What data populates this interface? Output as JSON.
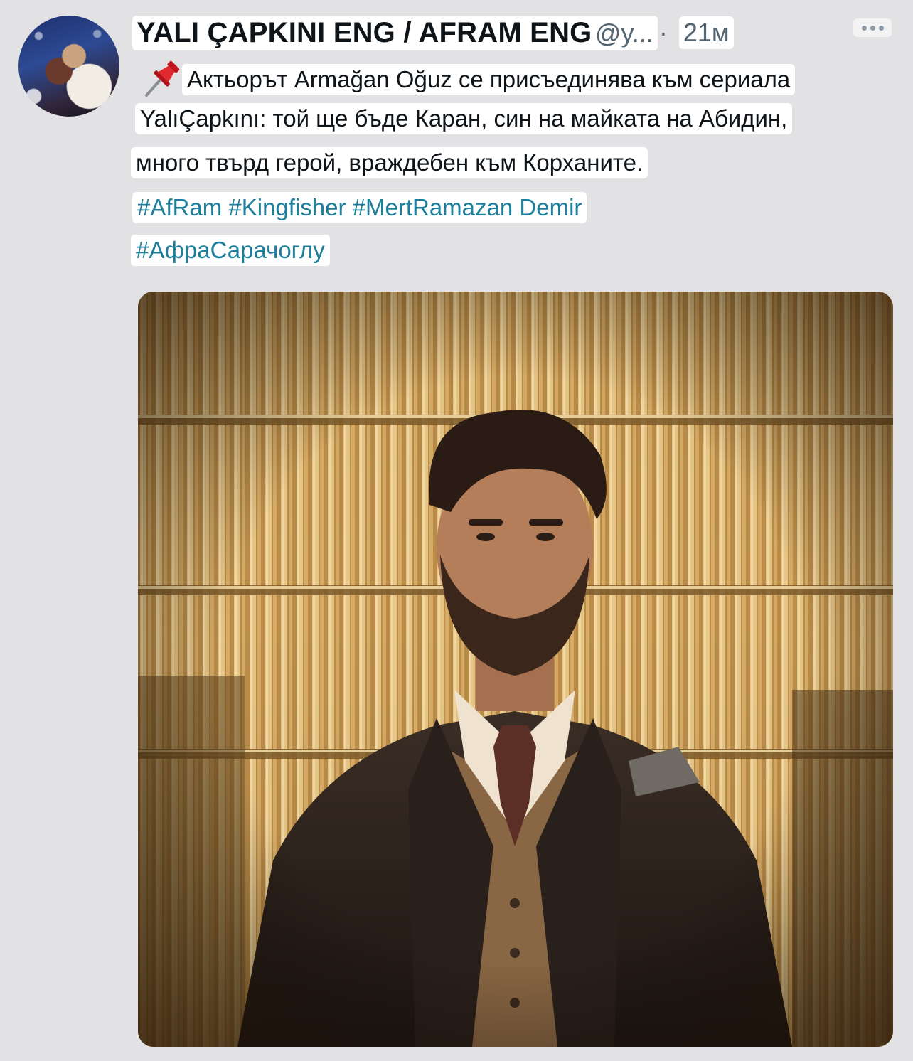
{
  "tweet": {
    "display_name": "YALI ÇAPKINI ENG / AFRAM ENG",
    "handle": "@y...",
    "separator": "·",
    "time": "21м",
    "text_line1": "Актьорът Armağan Oğuz се присъединява към сериала",
    "text_line2": "YalıÇapkını: той ще бъде Каран, син на майката на Абидин,",
    "text_line3": "много твърд герой, враждебен към Корханите.",
    "hashtags_line1": "#AfRam #Kingfisher #MertRamazan Demir",
    "hashtags_line2": "#АфраСарачоглу"
  },
  "icons": {
    "pin": "pushpin-icon",
    "more": "more-horizontal-icon"
  },
  "colors": {
    "background": "#e2e2e4",
    "hashtag": "#1d7f9b",
    "handle": "#536471",
    "text": "#0f1419"
  }
}
